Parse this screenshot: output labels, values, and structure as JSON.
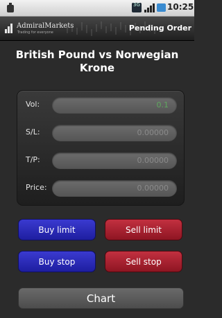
{
  "statusbar": {
    "network_label": "3G",
    "time": "10:25 AM",
    "icons": [
      "battery-indicator-icon",
      "network-3g-icon",
      "signal-strength-icon",
      "battery-icon"
    ]
  },
  "titlebar": {
    "logo_text": "AdmiralMarkets",
    "logo_tagline": "Trading for everyone",
    "screen_title": "Pending Order"
  },
  "instrument": {
    "name": "British Pound vs Norwegian Krone"
  },
  "form": {
    "rows": [
      {
        "label": "Vol:",
        "value": "0.1"
      },
      {
        "label": "S/L:",
        "value": "0.00000"
      },
      {
        "label": "T/P:",
        "value": "0.00000"
      },
      {
        "label": "Price:",
        "value": "0.00000"
      }
    ]
  },
  "buttons": {
    "buy_limit": "Buy limit",
    "sell_limit": "Sell limit",
    "buy_stop": "Buy stop",
    "sell_stop": "Sell stop",
    "chart": "Chart"
  },
  "colors": {
    "buy": "#2a2ab8",
    "sell": "#a81f2e",
    "vol_value": "#5fa85f",
    "background": "#2b2b2b"
  }
}
